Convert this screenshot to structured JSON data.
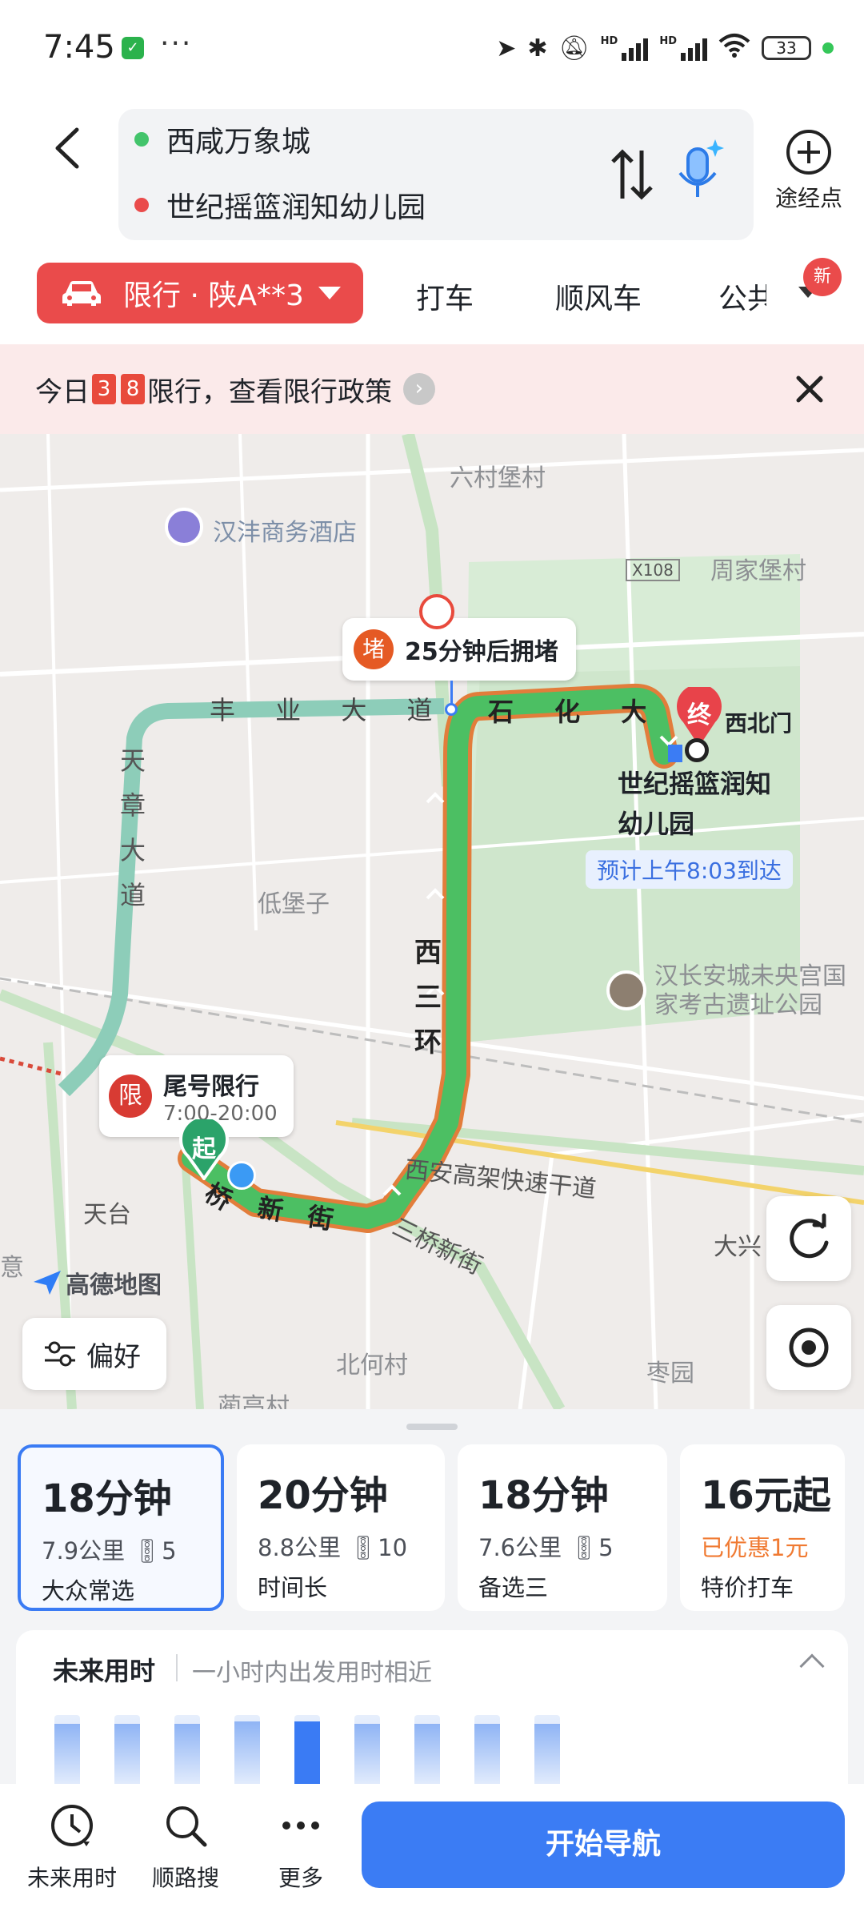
{
  "status_bar": {
    "time": "7:45",
    "battery": "33",
    "dots": "···"
  },
  "header": {
    "origin": "西咸万象城",
    "destination": "世纪摇篮润知幼儿园",
    "waypoint_label": "途经点"
  },
  "modes": {
    "active": "限行 · 陕A**3",
    "taxi": "打车",
    "carpool": "顺风车",
    "transit": "公共",
    "new_badge": "新"
  },
  "notice": {
    "prefix": "今日",
    "num1": "3",
    "num2": "8",
    "suffix": "限行，查看限行政策"
  },
  "map": {
    "labels": {
      "liucunpu": "六村堡村",
      "hotel": "汉沣商务酒店",
      "x108": "X108",
      "zhoujiapu": "周家堡村",
      "fengye": "丰 业 大 道",
      "shihua": "石 化 大 道",
      "tianzhang": "天章大道",
      "dipuzi": "低堡子",
      "xisanhuan": "西三环",
      "park": "汉长安城未央宫国家考古遗址公园",
      "gaojia": "西安高架快速干道",
      "sanqiao": "三桥新街",
      "daxing": "大兴",
      "tiantai": "天台",
      "beihe": "北何村",
      "zao": "枣园",
      "lan": "蔺高村",
      "yi": "意",
      "xinjie": "新 街",
      "qiao": "桥",
      "gate": "西北门",
      "dest_name": "世纪摇篮润知幼儿园",
      "eta": "预计上午8:03到达"
    },
    "congestion": {
      "badge": "堵",
      "text": "25分钟后拥堵"
    },
    "restriction": {
      "badge": "限",
      "title": "尾号限行",
      "hours": "7:00-20:00"
    },
    "start_marker": "起",
    "end_marker": "终",
    "logo": "高德地图",
    "preference": "偏好"
  },
  "routes": [
    {
      "time": "18分钟",
      "distance": "7.9公里",
      "lights": "5",
      "tag": "大众常选",
      "selected": true
    },
    {
      "time": "20分钟",
      "distance": "8.8公里",
      "lights": "10",
      "tag": "时间长",
      "selected": false
    },
    {
      "time": "18分钟",
      "distance": "7.6公里",
      "lights": "5",
      "tag": "备选三",
      "selected": false
    },
    {
      "time": "16元起",
      "discount": "已优惠1元",
      "tag": "特价打车"
    }
  ],
  "future": {
    "title": "未来用时",
    "subtitle": "一小时内出发用时相近",
    "bars": [
      0.88,
      0.88,
      0.88,
      0.92,
      0.92,
      0.88,
      0.88,
      0.88,
      0.88
    ],
    "active_index": 4
  },
  "bottom": {
    "future_label": "未来用时",
    "search_label": "顺路搜",
    "more_label": "更多",
    "start_label": "开始导航"
  },
  "colors": {
    "accent": "#3b7cf4",
    "restrict_red": "#ea4b4b",
    "route_green": "#4cbf63"
  }
}
